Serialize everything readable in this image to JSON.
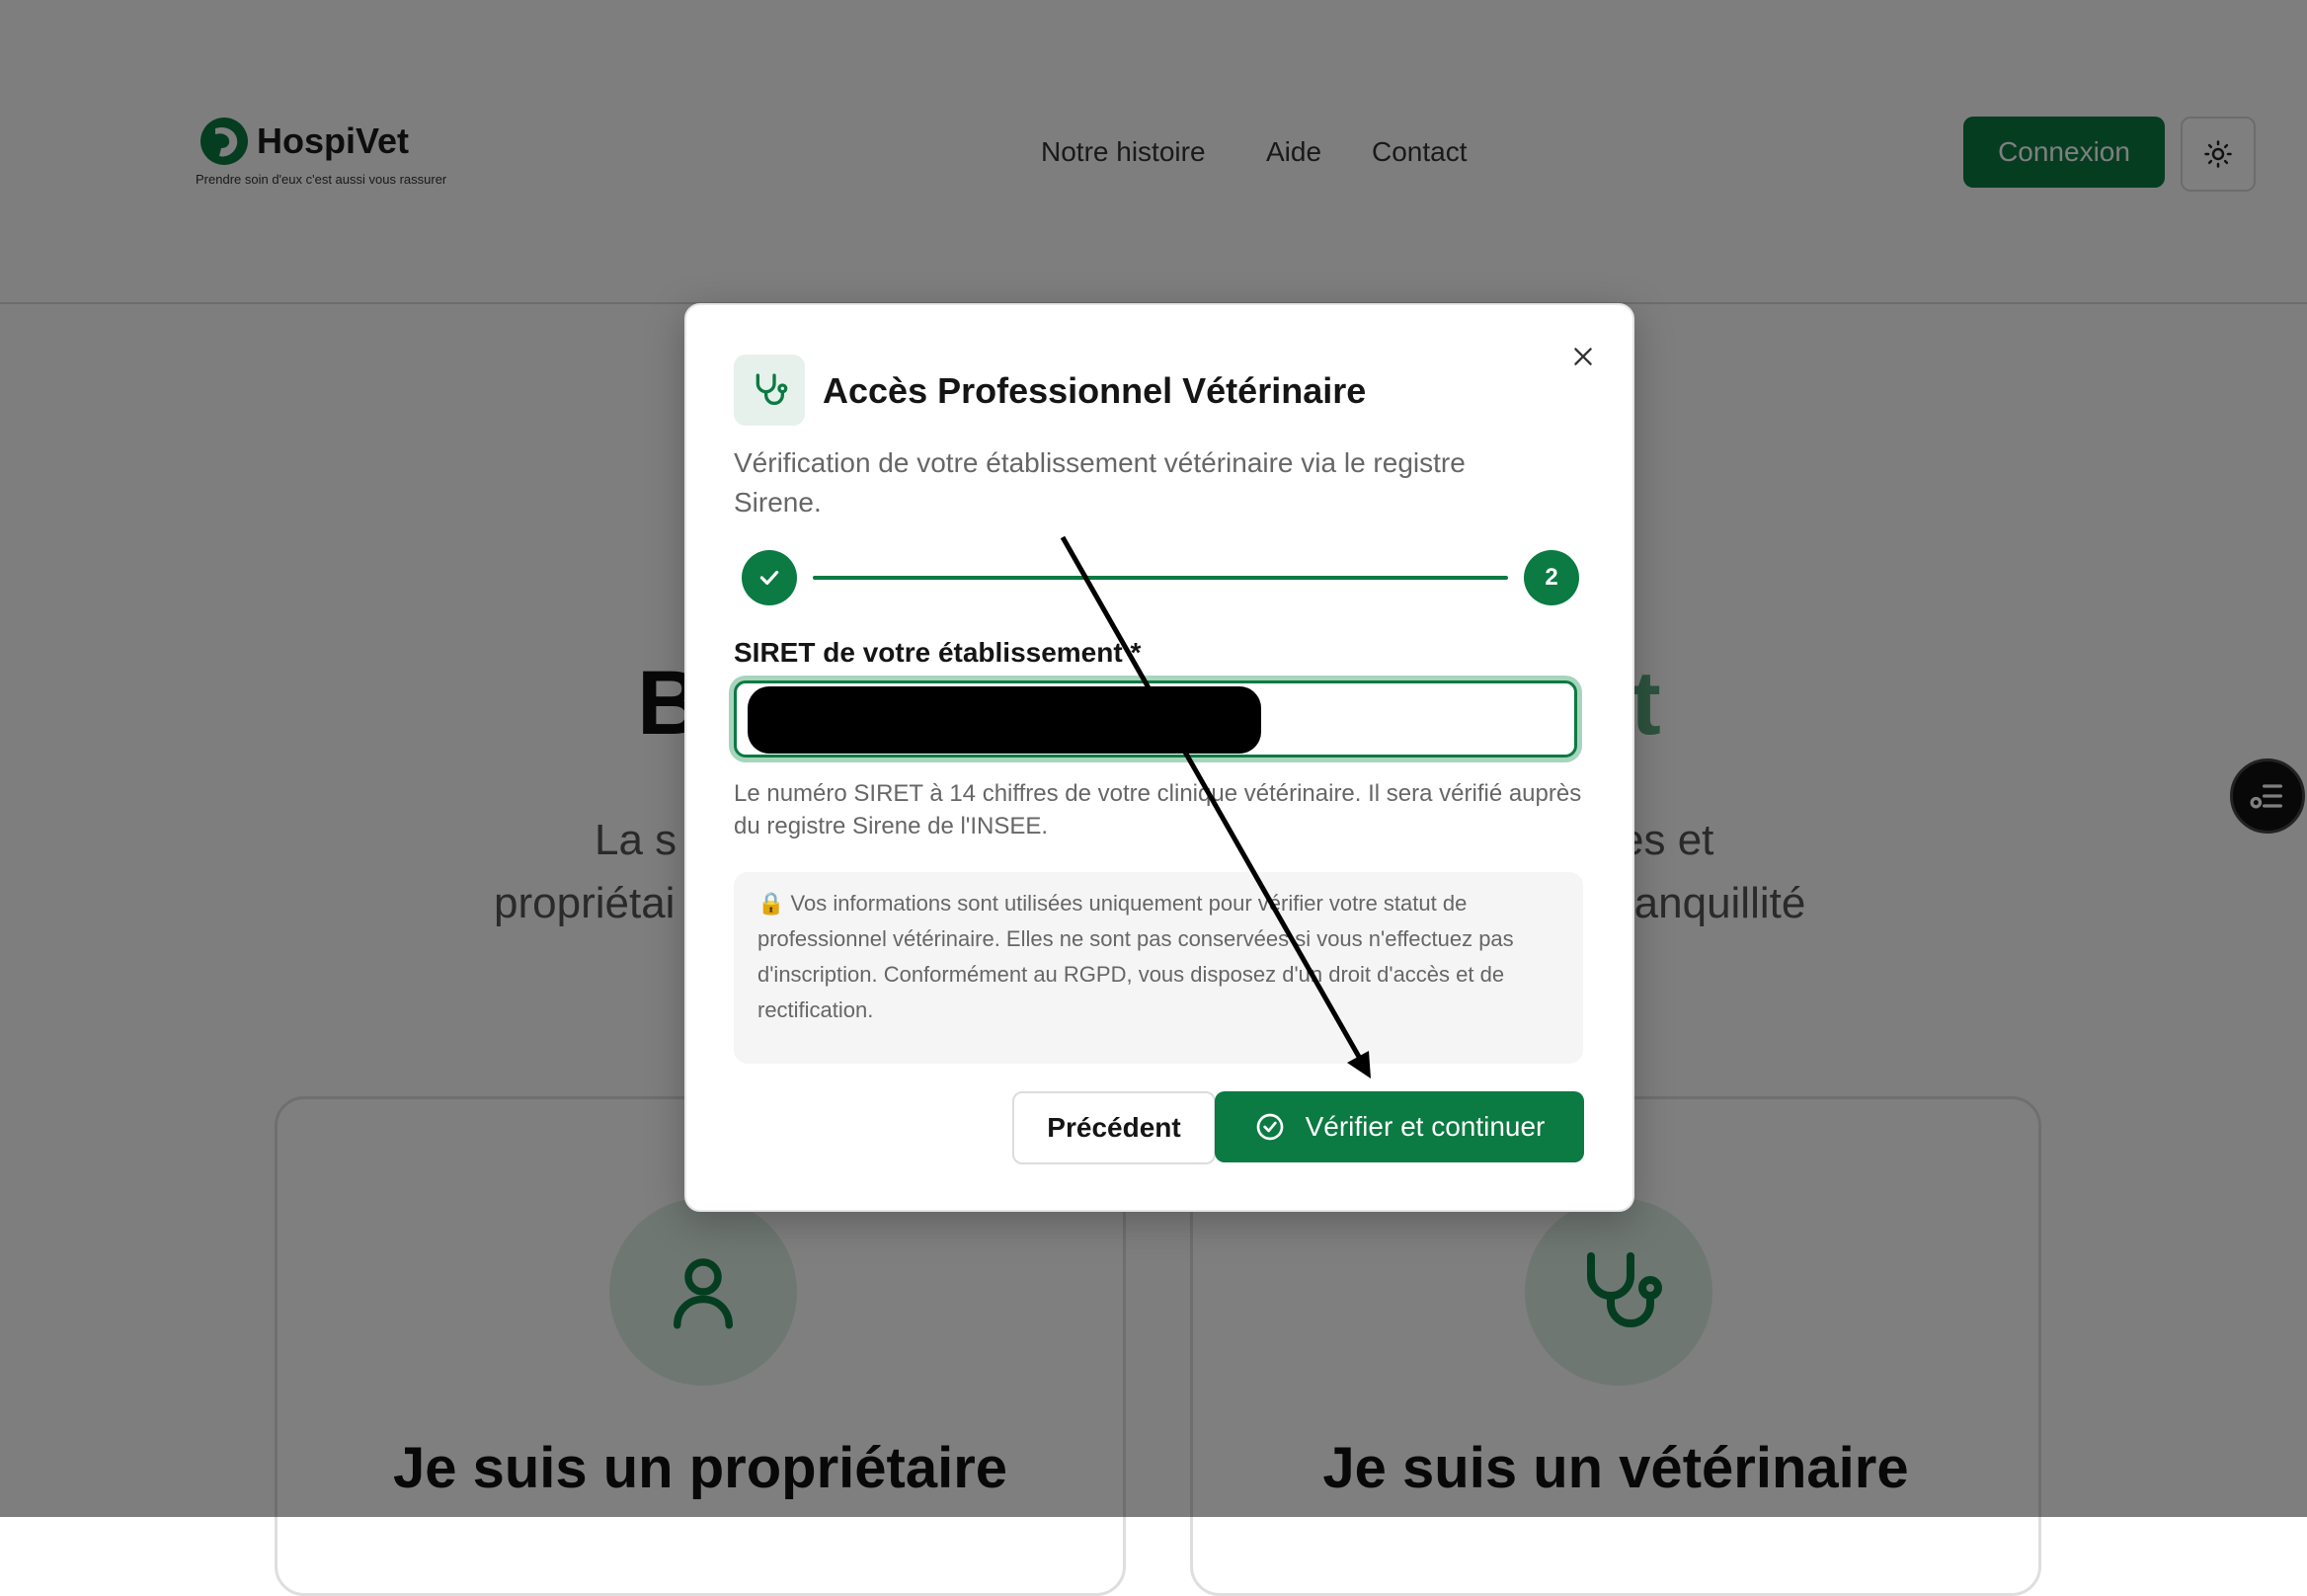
{
  "header": {
    "brand_name": "HospiVet",
    "brand_tagline": "Prendre soin d'eux c'est aussi vous rassurer",
    "nav": [
      "Notre histoire",
      "Aide",
      "Contact"
    ],
    "login_label": "Connexion",
    "theme_icon": "sun-icon"
  },
  "hero": {
    "title_left": "B",
    "title_right": "et",
    "subtitle_left_1": "La s",
    "subtitle_right_1": "es et",
    "subtitle_left_2": "propriétai",
    "subtitle_right_2": "ranquillité"
  },
  "cards": [
    {
      "title": "Je suis un propriétaire",
      "icon": "user-icon"
    },
    {
      "title": "Je suis un vétérinaire",
      "icon": "stethoscope-icon"
    }
  ],
  "modal": {
    "title": "Accès Professionnel Vétérinaire",
    "description": "Vérification de votre établissement vétérinaire via le registre Sirene.",
    "stepper": {
      "step1_state": "completed",
      "step2_label": "2",
      "current_step": 2,
      "total_steps": 2
    },
    "siret_label": "SIRET de votre établissement *",
    "siret_value": "",
    "siret_help": "Le numéro SIRET à 14 chiffres de votre clinique vétérinaire. Il sera vérifié auprès du registre Sirene de l'INSEE.",
    "privacy_note": "🔒 Vos informations sont utilisées uniquement pour vérifier votre statut de professionnel vétérinaire. Elles ne sont pas conservées si vous n'effectuez pas d'inscription. Conformément au RGPD, vous disposez d'un droit d'accès et de rectification.",
    "prev_label": "Précédent",
    "verify_label": "Vérifier et continuer"
  },
  "colors": {
    "brand_green": "#0b7a43",
    "focus_ring": "#a8d4bd",
    "icon_bg": "#e6f1ec"
  }
}
